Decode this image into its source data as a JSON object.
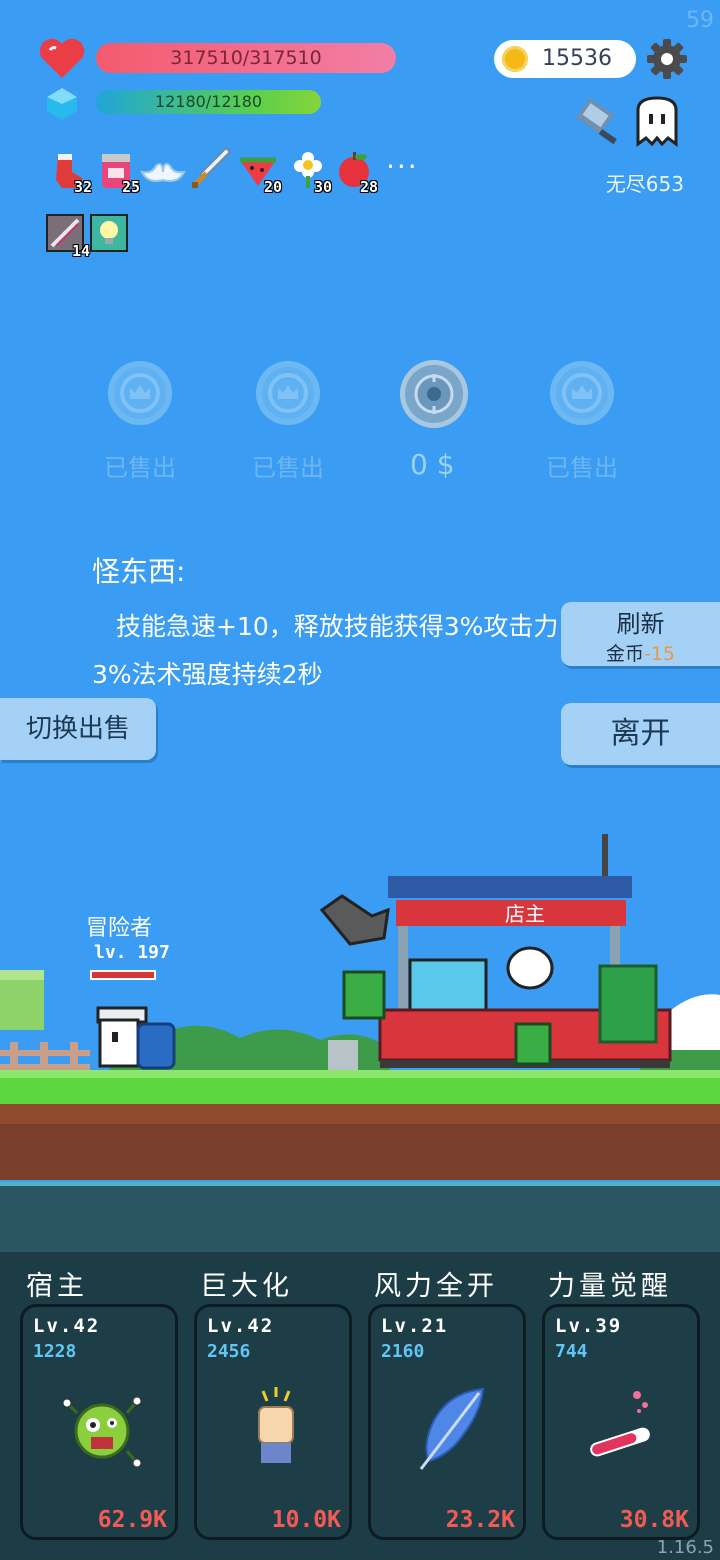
{
  "fps": "59",
  "version": "1.16.5",
  "player": {
    "hp_text": "317510/317510",
    "mp_text": "12180/12180"
  },
  "currency": {
    "gold": "15536",
    "icon": "gold-coin-icon"
  },
  "stage": {
    "label": "无尽653"
  },
  "inventory": {
    "items": [
      {
        "icon": "red-sock-icon",
        "count": "32"
      },
      {
        "icon": "jam-jar-icon",
        "count": "25"
      },
      {
        "icon": "angel-wings-icon",
        "count": ""
      },
      {
        "icon": "sword-icon",
        "count": ""
      },
      {
        "icon": "watermelon-icon",
        "count": "20"
      },
      {
        "icon": "flower-icon",
        "count": "30"
      },
      {
        "icon": "apple-icon",
        "count": "28"
      }
    ],
    "more": "···",
    "row2": [
      {
        "icon": "crossbow-icon",
        "count": "14"
      },
      {
        "icon": "lightbulb-icon",
        "count": ""
      }
    ]
  },
  "shop": {
    "slots": [
      {
        "state": "sold",
        "label": "已售出"
      },
      {
        "state": "sold",
        "label": "已售出"
      },
      {
        "state": "active",
        "label": "0 $"
      },
      {
        "state": "sold",
        "label": "已售出"
      }
    ],
    "item_title": "怪东西:",
    "item_desc": "技能急速+10，释放技能获得3%攻击力3%法术强度持续2秒",
    "refresh_label": "刷新",
    "refresh_cost_prefix": "金币",
    "refresh_cost": "-15",
    "leave_label": "离开",
    "switch_label": "切换出售"
  },
  "scene": {
    "hero_name": "冒险者",
    "hero_level": "lv. 197",
    "hero_hp_fraction": 1.0,
    "shopkeeper_label": "店主"
  },
  "skills": [
    {
      "name": "宿主",
      "level": "Lv.42",
      "power": "1228",
      "cost": "62.9K",
      "icon": "green-virus-icon"
    },
    {
      "name": "巨大化",
      "level": "Lv.42",
      "power": "2456",
      "cost": "10.0K",
      "icon": "raised-fist-icon"
    },
    {
      "name": "风力全开",
      "level": "Lv.21",
      "power": "2160",
      "cost": "23.2K",
      "icon": "blue-feather-icon"
    },
    {
      "name": "力量觉醒",
      "level": "Lv.39",
      "power": "744",
      "cost": "30.8K",
      "icon": "potion-tube-icon"
    }
  ]
}
